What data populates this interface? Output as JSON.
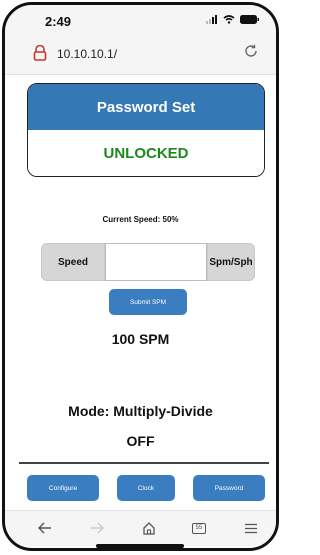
{
  "status": {
    "time": "2:49"
  },
  "browser": {
    "url": "10.10.10.1/"
  },
  "password": {
    "title": "Password Set",
    "state": "UNLOCKED"
  },
  "speed": {
    "current_label": "Current Speed: 50%",
    "prefix_label": "Speed",
    "suffix_label": "Spm/Sph",
    "input_value": "",
    "submit_label": "Submit SPM",
    "spm_value": "100 SPM"
  },
  "mode": {
    "label": "Mode: Multiply-Divide",
    "state": "OFF"
  },
  "nav": {
    "configure": "Configure",
    "clock": "Clock",
    "password": "Password"
  },
  "toolbar": {
    "tabs_count": "55"
  },
  "colors": {
    "accent": "#3a7dc0",
    "header": "#3479b5",
    "unlocked": "#1b8a1b"
  }
}
